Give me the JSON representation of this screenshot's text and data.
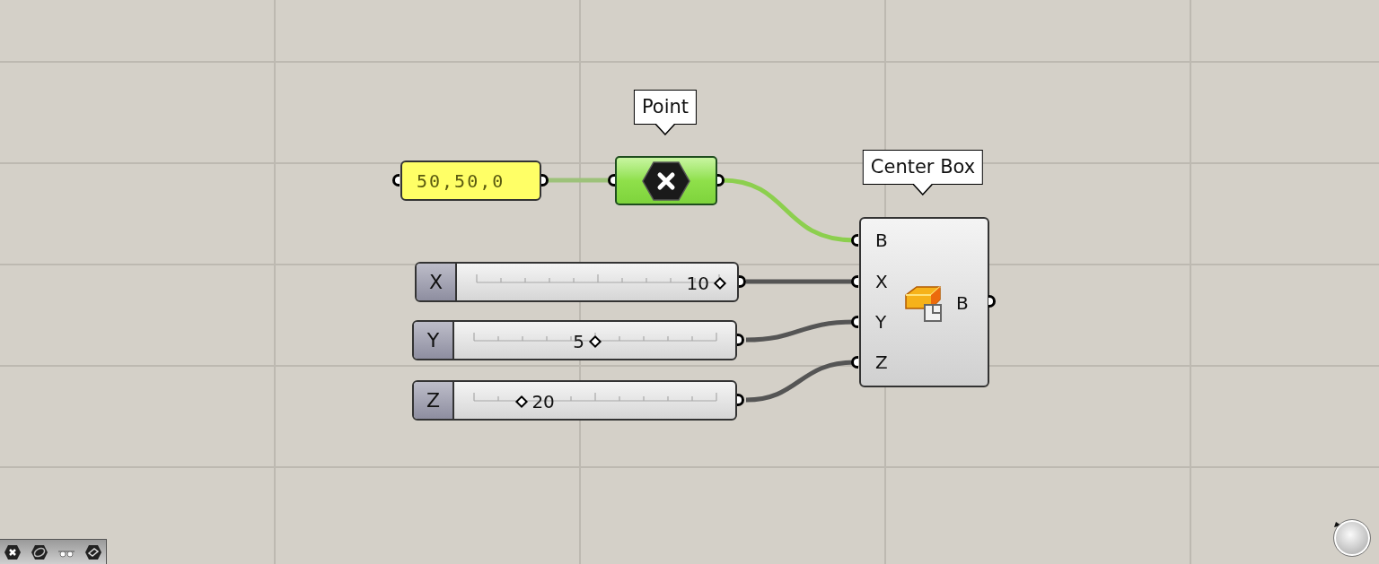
{
  "canvas": {
    "panel": {
      "text": "50,50,0"
    },
    "point": {
      "tooltip": "Point"
    },
    "center_box": {
      "tooltip": "Center Box",
      "inputs": [
        "B",
        "X",
        "Y",
        "Z"
      ],
      "outputs": [
        "B"
      ]
    },
    "sliders": [
      {
        "label": "X",
        "value": "10",
        "level": 1.0
      },
      {
        "label": "Y",
        "value": "5",
        "level": 0.5
      },
      {
        "label": "Z",
        "value": "20",
        "level": 0.2
      }
    ]
  }
}
